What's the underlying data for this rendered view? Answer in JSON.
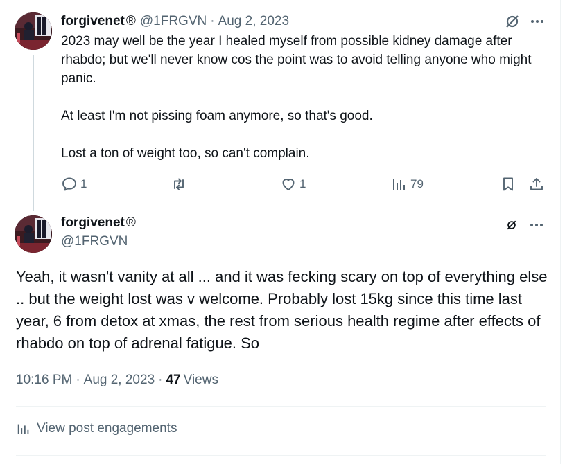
{
  "tweet1": {
    "display_name": "forgivenet",
    "badge": "®",
    "handle": "@1FRGVN",
    "separator": "·",
    "date": "Aug 2, 2023",
    "paragraphs": [
      "2023 may well be the year I healed myself from possible kidney damage after rhabdo; but we'll never know cos the point was to avoid telling anyone who might panic.",
      "At least I'm not pissing foam anymore, so that's good.",
      "Lost a ton of weight too, so can't complain."
    ],
    "actions": {
      "reply_count": "1",
      "retweet_count": "",
      "like_count": "1",
      "view_count": "79"
    }
  },
  "tweet2": {
    "display_name": "forgivenet",
    "badge": "®",
    "handle": "@1FRGVN",
    "text": "Yeah, it wasn't vanity at all ... and it was fecking scary on top of everything else .. but the weight lost was v welcome. Probably lost 15kg since this time last year, 6 from detox at xmas, the rest from serious health regime after effects of rhabdo on top of adrenal fatigue. So",
    "time": "10:16 PM",
    "separator": "·",
    "date": "Aug 2, 2023",
    "views_count": "47",
    "views_label": "Views",
    "engagements_label": "View post engagements"
  },
  "colors": {
    "text": "#0f1419",
    "muted": "#536471",
    "border": "#eff3f4",
    "thread_line": "#cfd9de"
  },
  "icons": [
    "grok-icon",
    "more-icon",
    "reply-icon",
    "retweet-icon",
    "like-icon",
    "views-icon",
    "bookmark-icon",
    "share-icon",
    "analytics-icon"
  ]
}
